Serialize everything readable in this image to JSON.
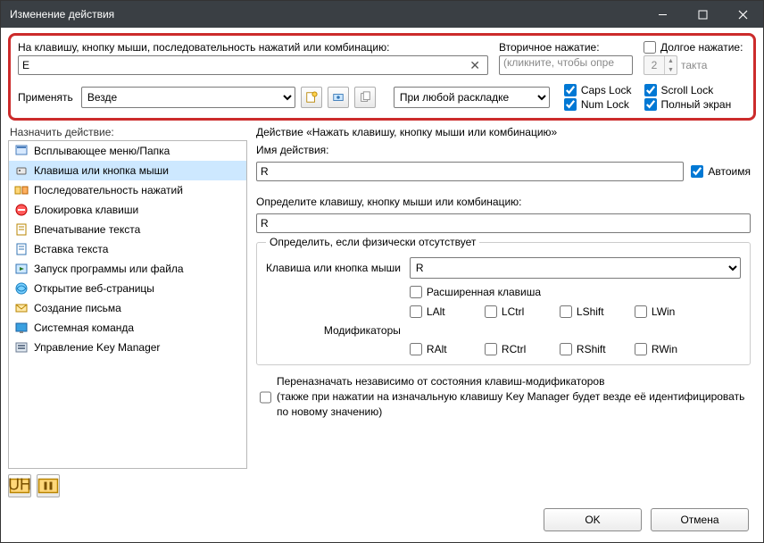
{
  "title": "Изменение действия",
  "top": {
    "key_label": "На клавишу, кнопку мыши, последовательность нажатий или комбинацию:",
    "key_value": "E",
    "secondary_label": "Вторичное нажатие:",
    "secondary_placeholder": "(кликните, чтобы опре",
    "long_label": "Долгое нажатие:",
    "long_value": "2",
    "long_unit": "такта",
    "apply_label": "Применять",
    "apply_value": "Везде",
    "layout_value": "При любой раскладке",
    "locks": {
      "caps": "Caps Lock",
      "num": "Num Lock",
      "scroll": "Scroll Lock",
      "full": "Полный экран"
    }
  },
  "left_header": "Назначить действие:",
  "actions": [
    "Всплывающее меню/Папка",
    "Клавиша или кнопка мыши",
    "Последовательность нажатий",
    "Блокировка клавиши",
    "Впечатывание текста",
    "Вставка текста",
    "Запуск программы или файла",
    "Открытие веб-страницы",
    "Создание письма",
    "Системная команда",
    "Управление Key Manager"
  ],
  "right": {
    "header": "Действие «Нажать клавишу, кнопку мыши или комбинацию»",
    "name_label": "Имя действия:",
    "name_value": "R",
    "autoname": "Автоимя",
    "define_label": "Определите клавишу, кнопку мыши или комбинацию:",
    "define_value": "R",
    "group_legend": "Определить, если физически отсутствует",
    "key_label": "Клавиша или кнопка мыши",
    "key_value": "R",
    "ext_label": "Расширенная клавиша",
    "mod_label": "Модификаторы",
    "mods": [
      "LAlt",
      "LCtrl",
      "LShift",
      "LWin",
      "RAlt",
      "RCtrl",
      "RShift",
      "RWin"
    ],
    "reassign": "Переназначать независимо от состояния клавиш-модификаторов",
    "reassign2": "(также при нажатии на изначальную клавишу Key Manager будет везде её идентифицировать по новому значению)"
  },
  "buttons": {
    "ok": "OK",
    "cancel": "Отмена"
  }
}
